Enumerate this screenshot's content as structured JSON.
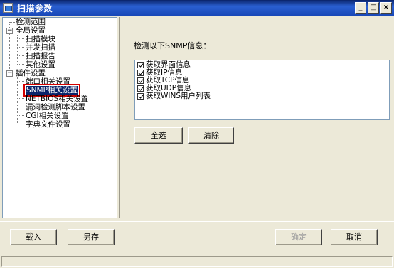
{
  "window": {
    "title": "扫描参数",
    "minimize": "_",
    "maximize": "□",
    "close": "×"
  },
  "tree": {
    "detect_range": "检测范围",
    "global_settings": "全局设置",
    "global_children": [
      "扫描模块",
      "并发扫描",
      "扫描报告",
      "其他设置"
    ],
    "plugin_settings": "插件设置",
    "plugin_children": [
      "端口相关设置",
      "SNMP相关设置",
      "NETBIOS相关设置",
      "漏洞检测脚本设置",
      "CGI相关设置",
      "字典文件设置"
    ],
    "expander_minus": "−"
  },
  "content": {
    "prompt": "检测以下SNMP信息：",
    "items": [
      "获取界面信息",
      "获取IP信息",
      "获取TCP信息",
      "获取UDP信息",
      "获取WINS用户列表"
    ],
    "select_all": "全选",
    "clear": "清除"
  },
  "footer": {
    "load": "载入",
    "save_as": "另存",
    "ok": "确定",
    "cancel": "取消"
  }
}
